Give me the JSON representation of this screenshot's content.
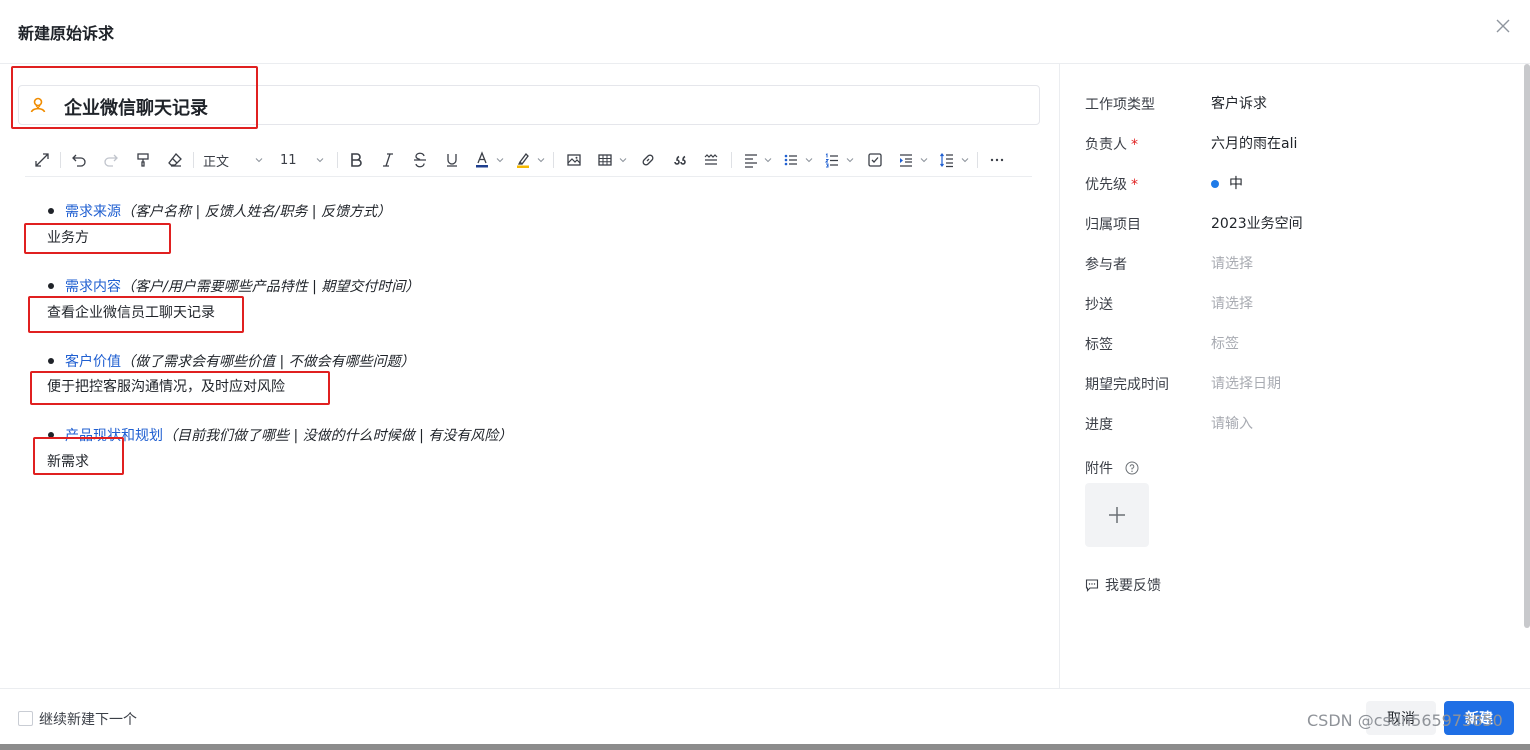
{
  "dialog": {
    "title": "新建原始诉求"
  },
  "editor": {
    "title_value": "企业微信聊天记录",
    "toolbar": {
      "paragraph_style": "正文",
      "font_size": "11"
    },
    "sections": [
      {
        "label": "需求来源",
        "hint": "（客户名称 | 反馈人姓名/职务 | 反馈方式）",
        "answer": "业务方"
      },
      {
        "label": "需求内容",
        "hint": "（客户/用户需要哪些产品特性 | 期望交付时间）",
        "answer": "查看企业微信员工聊天记录"
      },
      {
        "label": "客户价值",
        "hint": "（做了需求会有哪些价值 | 不做会有哪些问题）",
        "answer": "便于把控客服沟通情况，及时应对风险"
      },
      {
        "label": "产品现状和规划",
        "hint": "（目前我们做了哪些 | 没做的什么时候做 | 有没有风险）",
        "answer": "新需求"
      }
    ]
  },
  "sidebar": {
    "fields": [
      {
        "label": "工作项类型",
        "required": false,
        "value": "客户诉求",
        "placeholder": false
      },
      {
        "label": "负责人",
        "required": true,
        "value": "六月的雨在ali",
        "placeholder": false
      },
      {
        "label": "优先级",
        "required": true,
        "value": "中",
        "placeholder": false
      },
      {
        "label": "归属项目",
        "required": false,
        "value": "2023业务空间",
        "placeholder": false
      },
      {
        "label": "参与者",
        "required": false,
        "value": "请选择",
        "placeholder": true
      },
      {
        "label": "抄送",
        "required": false,
        "value": "请选择",
        "placeholder": true
      },
      {
        "label": "标签",
        "required": false,
        "value": "标签",
        "placeholder": true
      },
      {
        "label": "期望完成时间",
        "required": false,
        "value": "请选择日期",
        "placeholder": true
      },
      {
        "label": "进度",
        "required": false,
        "value": "请输入",
        "placeholder": true
      }
    ],
    "required_mark": "*",
    "attachment_label": "附件",
    "feedback_label": "我要反馈"
  },
  "footer": {
    "continue_label": "继续新建下一个",
    "cancel_label": "取消",
    "create_label": "新建",
    "watermark": "CSDN @csdn565973850"
  },
  "colors": {
    "accent": "#1f6fe5",
    "link": "#1f5fd1",
    "annotation_red": "#e02020",
    "priority_dot": "#1f7be8"
  }
}
